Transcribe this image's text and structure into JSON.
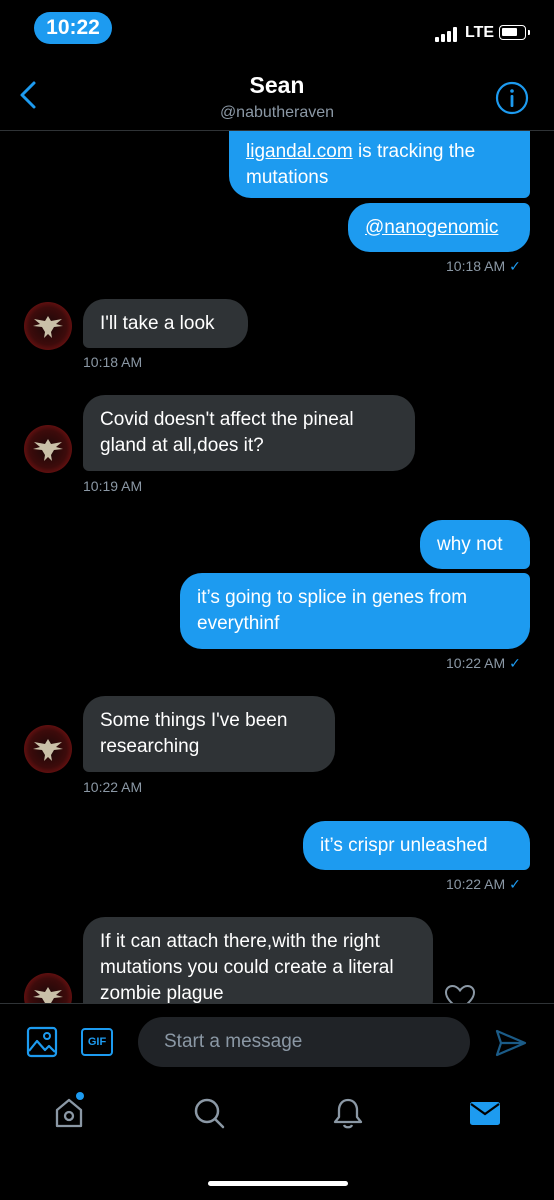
{
  "status_bar": {
    "time": "10:22",
    "network": "LTE",
    "accent": "#1d9bf0"
  },
  "header": {
    "name": "Sean",
    "handle": "@nabutheraven"
  },
  "messages": [
    {
      "from": "me",
      "link": "ligandal.com",
      "text": " is tracking the mutations"
    },
    {
      "from": "me",
      "link": "@nanogenomic"
    },
    {
      "from": "me",
      "time": "10:18 AM",
      "status": "sent-check"
    },
    {
      "from": "them",
      "text": "I'll take a look",
      "time": "10:18 AM"
    },
    {
      "from": "them",
      "text": "Covid doesn't affect the pineal gland at all,does it?",
      "time": "10:19 AM"
    },
    {
      "from": "me",
      "text": "why not"
    },
    {
      "from": "me",
      "text": "it’s going to splice in genes from everythinf",
      "time": "10:22 AM"
    },
    {
      "from": "them",
      "text": "Some things I've been researching",
      "time": "10:22 AM"
    },
    {
      "from": "me",
      "text": "it’s crispr unleashed",
      "time": "10:22 AM"
    },
    {
      "from": "them",
      "text": "If it can attach there,with the right mutations you could create a literal zombie plague"
    }
  ],
  "composer": {
    "placeholder": "Start a message",
    "gif_label": "GIF"
  },
  "tabs": [
    "home-icon",
    "search-icon",
    "bell-icon",
    "mail-icon"
  ],
  "colors": {
    "sent_bubble": "#1d9bf0",
    "received_bubble": "#2f3336",
    "muted_text": "#8b98a5"
  }
}
